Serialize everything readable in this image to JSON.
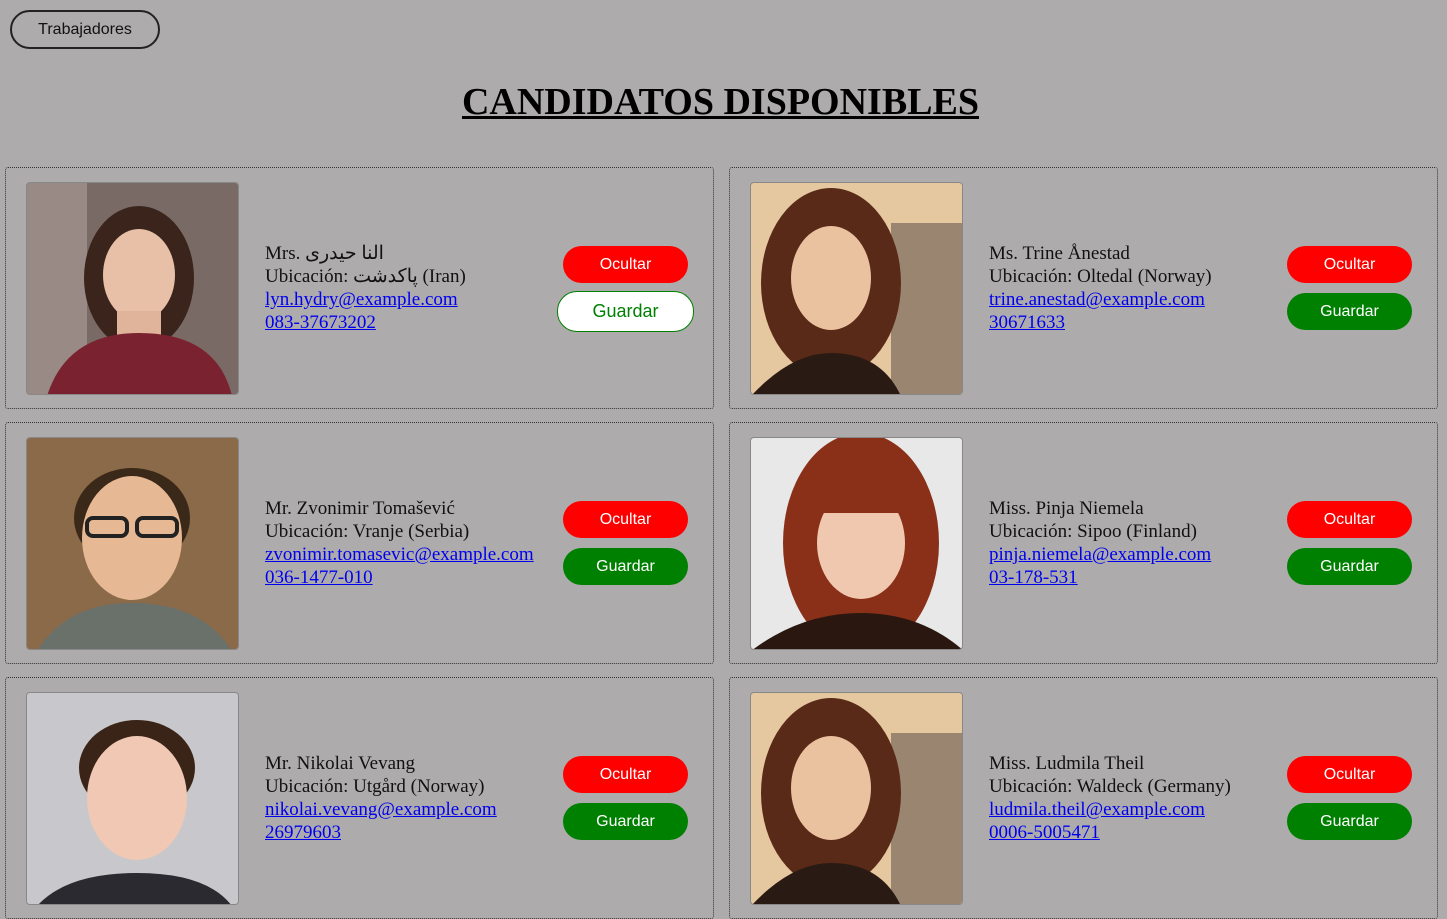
{
  "nav": {
    "workers_label": "Trabajadores"
  },
  "page": {
    "title": "CANDIDATOS DISPONIBLES"
  },
  "buttons": {
    "hide_label": "Ocultar",
    "save_label": "Guardar"
  },
  "colors": {
    "background": "#adabac",
    "hide": "#ff0000",
    "save": "#008000",
    "link": "#0000ee"
  },
  "candidates": [
    {
      "name": "Mrs. النا حیدری",
      "location": "Ubicación: پاکدشت (Iran)",
      "email": "lyn.hydry@example.com",
      "phone": "083-37673202",
      "save_style": "outline"
    },
    {
      "name": "Ms. Trine Ånestad",
      "location": "Ubicación: Oltedal (Norway)",
      "email": "trine.anestad@example.com",
      "phone": "30671633",
      "save_style": "solid"
    },
    {
      "name": "Mr. Zvonimir Tomašević",
      "location": "Ubicación: Vranje (Serbia)",
      "email": "zvonimir.tomasevic@example.com",
      "phone": "036-1477-010",
      "save_style": "solid"
    },
    {
      "name": "Miss. Pinja Niemela",
      "location": "Ubicación: Sipoo (Finland)",
      "email": "pinja.niemela@example.com",
      "phone": "03-178-531",
      "save_style": "solid"
    },
    {
      "name": "Mr. Nikolai Vevang",
      "location": "Ubicación: Utgård (Norway)",
      "email": "nikolai.vevang@example.com",
      "phone": "26979603",
      "save_style": "solid"
    },
    {
      "name": "Miss. Ludmila Theil",
      "location": "Ubicación: Waldeck (Germany)",
      "email": "ludmila.theil@example.com",
      "phone": "0006-5005471",
      "save_style": "solid"
    }
  ]
}
